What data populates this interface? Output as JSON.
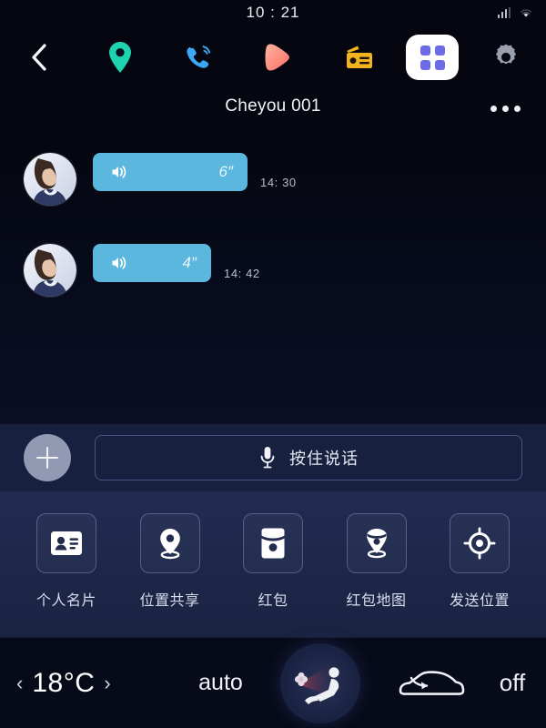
{
  "status_bar": {
    "time": "10 : 21",
    "signal_icon": "signal-bars-icon",
    "wifi_icon": "wifi-icon"
  },
  "app_bar": {
    "items": [
      {
        "name": "back-icon",
        "label": "Back"
      },
      {
        "name": "map-pin-icon",
        "label": "Navigation",
        "color": "#1ed3b0"
      },
      {
        "name": "phone-icon",
        "label": "Phone",
        "color": "#3ba7f5"
      },
      {
        "name": "media-icon",
        "label": "Media",
        "color": "#ff8b7a"
      },
      {
        "name": "radio-icon",
        "label": "Radio",
        "color": "#f3b31f"
      },
      {
        "name": "apps-grid-icon",
        "label": "Apps",
        "color": "#6c6ce8",
        "active": true
      },
      {
        "name": "gear-icon",
        "label": "Settings",
        "color": "#9aa0ad"
      }
    ]
  },
  "chat": {
    "title": "Cheyou 001",
    "more_icon": "more-dots-icon",
    "bubble_color": "#5bb7de",
    "messages": [
      {
        "avatar": "contact-avatar",
        "voice_icon": "speaker-wave-icon",
        "duration": "6″",
        "time": "14: 30",
        "bubble_width": 170
      },
      {
        "avatar": "contact-avatar",
        "voice_icon": "speaker-wave-icon",
        "duration": "4″",
        "time": "14: 42",
        "bubble_width": 130
      }
    ]
  },
  "input_bar": {
    "add_icon": "plus-icon",
    "mic_icon": "microphone-icon",
    "hold_to_talk_label": "按住说话"
  },
  "function_grid": {
    "items": [
      {
        "icon": "contact-card-icon",
        "label": "个人名片"
      },
      {
        "icon": "location-pin-icon",
        "label": "位置共享"
      },
      {
        "icon": "red-packet-icon",
        "label": "红包"
      },
      {
        "icon": "red-packet-map-icon",
        "label": "红包地图"
      },
      {
        "icon": "send-location-icon",
        "label": "发送位置"
      }
    ]
  },
  "climate_bar": {
    "temp_decrease_icon": "chevron-left-icon",
    "temperature": "18°C",
    "temp_increase_icon": "chevron-right-icon",
    "auto_label": "auto",
    "airflow_icon": "seat-airflow-icon",
    "recirculation_icon": "car-recirculation-icon",
    "fan_state_label": "off"
  }
}
